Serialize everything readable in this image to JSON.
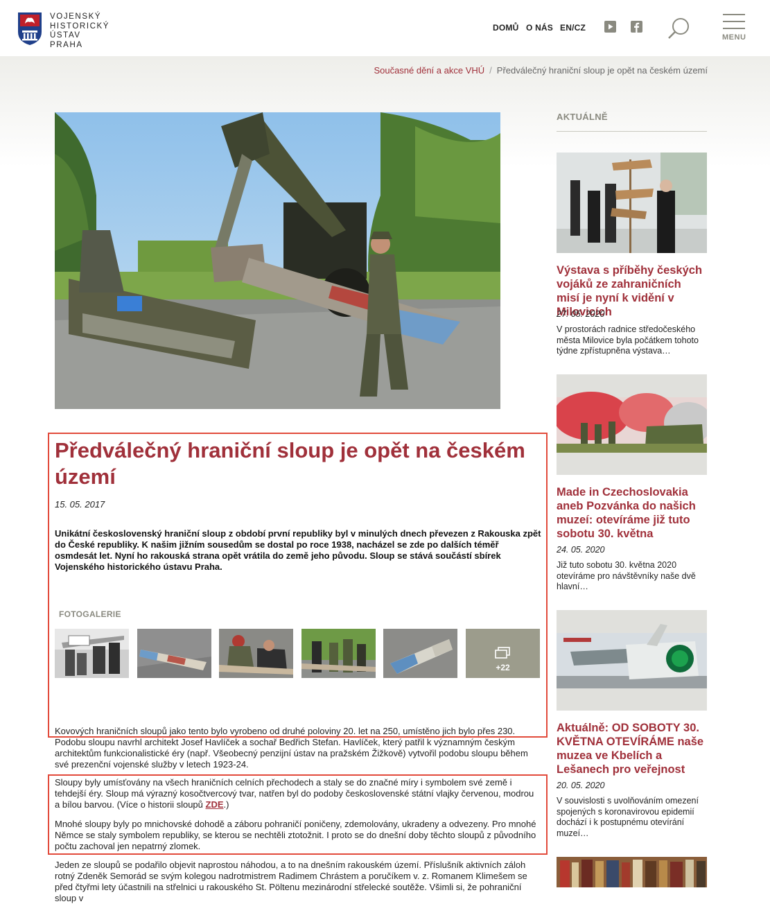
{
  "site": {
    "logo_line1": "VOJENSKÝ",
    "logo_line2": "HISTORICKÝ",
    "logo_line3": "ÚSTAV PRAHA"
  },
  "nav": {
    "items": [
      {
        "label": "DOMŮ"
      },
      {
        "label": "O NÁS"
      },
      {
        "label": "EN/CZ"
      }
    ],
    "menu_label": "MENU",
    "icons": [
      "youtube-icon",
      "facebook-icon",
      "search-icon",
      "hamburger-menu-icon"
    ]
  },
  "breadcrumb": {
    "parent": "Současné dění a akce VHÚ",
    "separator": "/",
    "current": "Předválečný hraniční sloup je opět na českém území"
  },
  "article": {
    "title": "Předválečný hraniční sloup je opět na českém území",
    "date": "15. 05. 2017",
    "lead": "Unikátní československý hraniční sloup z období první republiky byl v minulých dnech převezen z Rakouska zpět do České republiky. K našim jižním sousedům se dostal po roce 1938, nacházel se zde po dalších téměř osmdesát let. Nyní ho rakouská strana opět vrátila do země jeho původu. Sloup se stává součástí sbírek Vojenského historického ústavu Praha.",
    "gallery_label": "FOTOGALERIE",
    "gallery_more": "+22",
    "p1": "Kovových hraničních sloupů jako tento bylo vyrobeno od druhé poloviny 20. let na 250, umístěno jich bylo přes 230. Podobu sloupu navrhl architekt Josef Havlíček a sochař Bedřich Stefan. Havlíček, který patřil k významným českým architektům funkcionalistické éry (např. Všeobecný penzijní ústav na pražském Žižkově) vytvořil podobu sloupu během své prezenční vojenské služby v letech 1923-24.",
    "p2_text": "Sloupy byly umísťovány na všech hraničních celních přechodech a staly se do značné míry i symbolem své země i tehdejší éry. Sloup má výrazný kosočtvercový tvar, natřen byl do podoby československé státní vlajky červenou, modrou a bílou barvou. (Více o historii sloupů ",
    "p2_link": "ZDE",
    "p2_end": ".)",
    "p3": "Mnohé sloupy byly po mnichovské dohodě a záboru pohraničí poničeny, zdemolovány, ukradeny a odvezeny. Pro mnohé Němce se staly symbolem republiky, se kterou se nechtěli ztotožnit. I proto se do dnešní doby těchto sloupů z původního počtu zachoval jen nepatrný zlomek.",
    "p4": "Jeden ze sloupů se podařilo objevit naprostou náhodou, a to na dnešním rakouském území. Příslušník aktivních záloh rotný Zdeněk Semorád se svým kolegou nadrotmistrem Radimem Chrástem a poručíkem v. z. Romanem Klimešem se před čtyřmi lety účastnili na střelnici u rakouského St. Pöltenu mezinárodní střelecké soutěže. Všimli si, že pohraniční sloup v"
  },
  "aside": {
    "heading": "AKTUÁLNĚ",
    "news": [
      {
        "title": "Výstava s příběhy českých vojáků ze zahraničních misí je nyní k vidění v Milovicích",
        "date": "27. 05. 2020",
        "excerpt": "V prostorách radnice středočeského města Milovice byla počátkem tohoto týdne zpřístupněna výstava…"
      },
      {
        "title": "Made in Czechoslovakia aneb Pozvánka do našich muzeí: otevíráme již tuto sobotu 30. května",
        "date": "24. 05. 2020",
        "excerpt": "Již tuto sobotu 30. května 2020 otevíráme pro návštěvníky naše dvě hlavní…"
      },
      {
        "title": "Aktuálně: OD SOBOTY 30. KVĚTNA OTEVÍRÁME naše muzea ve Kbelích a Lešanech pro veřejnost",
        "date": "20. 05. 2020",
        "excerpt": "V souvislosti s uvolňováním omezení spojených s koronavirovou epidemií dochází i k postupnému otevírání muzeí…"
      }
    ]
  },
  "colors": {
    "accent": "#a0303a",
    "muted": "#8a8a80",
    "highlight": "#e24a3b"
  }
}
